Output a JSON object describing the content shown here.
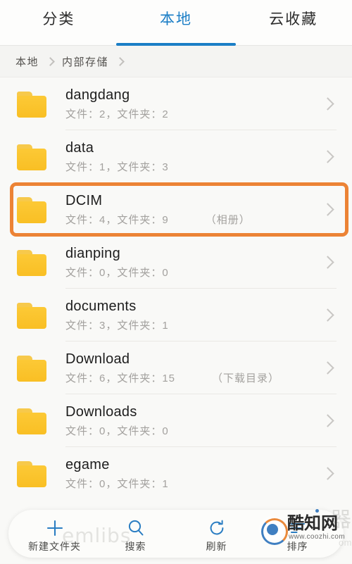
{
  "tabs": [
    {
      "label": "分类",
      "active": false
    },
    {
      "label": "本地",
      "active": true
    },
    {
      "label": "云收藏",
      "active": false
    }
  ],
  "breadcrumb": {
    "items": [
      "本地",
      "内部存储"
    ]
  },
  "list": {
    "rows": [
      {
        "name": "dangdang",
        "meta": "文件：2，文件夹：2",
        "note": ""
      },
      {
        "name": "data",
        "meta": "文件：1，文件夹：3",
        "note": ""
      },
      {
        "name": "DCIM",
        "meta": "文件：4，文件夹：9",
        "note": "（相册）",
        "highlighted": true
      },
      {
        "name": "dianping",
        "meta": "文件：0，文件夹：0",
        "note": ""
      },
      {
        "name": "documents",
        "meta": "文件：3，文件夹：1",
        "note": ""
      },
      {
        "name": "Download",
        "meta": "文件：6，文件夹：15",
        "note": "（下载目录）"
      },
      {
        "name": "Downloads",
        "meta": "文件：0，文件夹：0",
        "note": ""
      },
      {
        "name": "egame",
        "meta": "文件：0，文件夹：1",
        "note": ""
      }
    ]
  },
  "toolbar": {
    "items": [
      {
        "icon": "plus-icon",
        "label": "新建文件夹"
      },
      {
        "icon": "search-icon",
        "label": "搜索"
      },
      {
        "icon": "refresh-icon",
        "label": "刷新"
      },
      {
        "icon": "sort-icon",
        "label": "排序"
      }
    ]
  },
  "watermarks": {
    "emlibs": "emlibs",
    "site_name": "酷知网",
    "site_url": "www.coozhi.com",
    "ghost_name": "器",
    "ghost_url": "om"
  },
  "colors": {
    "accent_blue": "#1b7ec6",
    "highlight_orange": "#ec8335",
    "folder_yellow": "#fbc02d",
    "page_bg": "#f7f7f5"
  }
}
